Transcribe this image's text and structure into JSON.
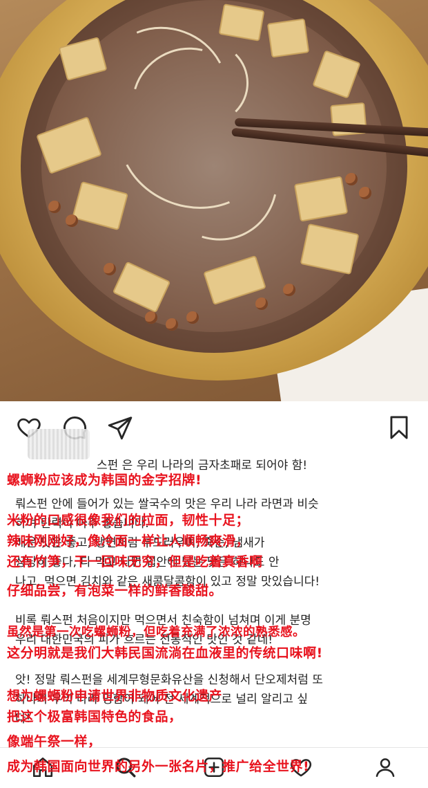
{
  "post": {
    "korean_lines": [
      "스펀 은 우리 나라의 금자초패로 되어야 함!",
      "뤄스펀 안에 들어가 있는 쌀국수의 맛은 우리 나라 라면과 비슷",
      "하며 탄력이 아주 좋습니다.",
      "매운 맛은 좋고, 냉면처럼 부드러우며, 죽순, 냄새가",
      "상당히 좋다, 다 먹고 나면 입안에 남는 맛은 하나도 안",
      "나고, 먹으면 김치와 같은 새콤달콤함이 있고 정말 맛있습니다!",
      "비록 뤄스펀 처음이지만 먹으면서 친숙함이 넘쳐며 이게 분명",
      "우리 대한민국의 피가 흐르는 전통적인 맛인 것 같네!",
      "앗! 정말 뤄스펀을 세계무형문화유산을 신청해서 단오제처럼 또",
      "하나의 우리 나라 명함이 돼어 전 세계적으로 널리 알리고 싶",
      "다!"
    ]
  },
  "overlay": {
    "lines": [
      "螺蛳粉应该成为韩国的金字招牌!",
      "米粉的口感很像我们的拉面，韧性十足；",
      "辣味刚刚好，像冷面一样让人顺畅爽滑，",
      "还有竹笋，干一回味无穷，但是吃着真香啊",
      "仔细品尝，有泡菜一样的鲜香酸甜。",
      "虽然是第一次吃螺蛳粉，但吃着充满了浓浓的熟悉感。",
      "这分明就是我们大韩民国流淌在血液里的传统口味啊!",
      "想为螺蛳粉申请世界非物质文化遗产",
      "把这个极富韩国特色的食品，",
      "像端午祭一样，",
      "成为韩国面向世界的另外一张名片，推广给全世界!"
    ],
    "color": "#e8131e"
  },
  "colors": {
    "icon": "#262626",
    "background": "#ffffff"
  },
  "icons": {
    "actions": [
      "heart-icon",
      "comment-icon",
      "share-icon",
      "bookmark-icon"
    ],
    "nav": [
      "home-icon",
      "search-icon",
      "add-icon",
      "activity-icon",
      "profile-icon"
    ]
  }
}
